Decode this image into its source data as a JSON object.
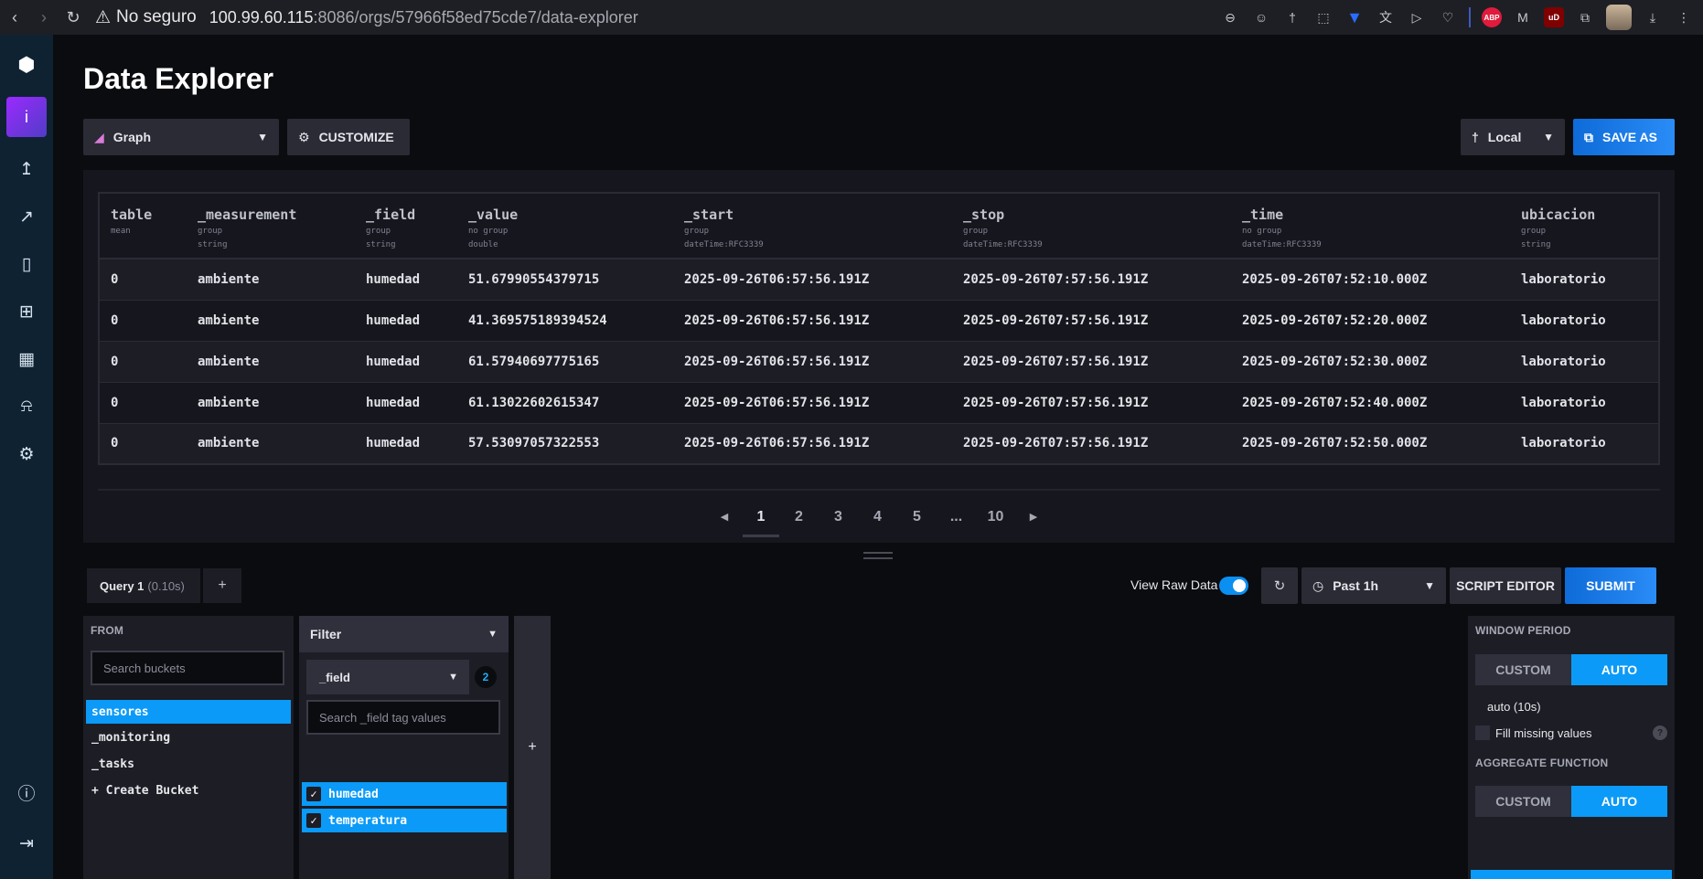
{
  "browser": {
    "security_label": "No seguro",
    "url_host": "100.99.60.115",
    "url_rest": ":8086/orgs/57966f58ed75cde7/data-explorer",
    "extensions": {
      "abp": "ABP",
      "ub": "uD"
    }
  },
  "sidebar": {
    "user_initial": "i",
    "icons": [
      "upload-icon",
      "chart-icon",
      "notebook-icon",
      "dashboard-icon",
      "calendar-icon",
      "bell-icon",
      "gear-icon"
    ],
    "bottom_icons": [
      "help-icon",
      "collapse-icon"
    ]
  },
  "page": {
    "title": "Data Explorer",
    "graph_type": "Graph",
    "customize_label": "CUSTOMIZE",
    "timezone_label": "Local",
    "save_as_label": "SAVE AS"
  },
  "table": {
    "columns": [
      {
        "name": "table",
        "meta1": "mean",
        "meta2": ""
      },
      {
        "name": "_measurement",
        "meta1": "group",
        "meta2": "string"
      },
      {
        "name": "_field",
        "meta1": "group",
        "meta2": "string"
      },
      {
        "name": "_value",
        "meta1": "no group",
        "meta2": "double"
      },
      {
        "name": "_start",
        "meta1": "group",
        "meta2": "dateTime:RFC3339"
      },
      {
        "name": "_stop",
        "meta1": "group",
        "meta2": "dateTime:RFC3339"
      },
      {
        "name": "_time",
        "meta1": "no group",
        "meta2": "dateTime:RFC3339"
      },
      {
        "name": "ubicacion",
        "meta1": "group",
        "meta2": "string"
      }
    ],
    "rows": [
      [
        "0",
        "ambiente",
        "humedad",
        "51.67990554379715",
        "2025-09-26T06:57:56.191Z",
        "2025-09-26T07:57:56.191Z",
        "2025-09-26T07:52:10.000Z",
        "laboratorio"
      ],
      [
        "0",
        "ambiente",
        "humedad",
        "41.369575189394524",
        "2025-09-26T06:57:56.191Z",
        "2025-09-26T07:57:56.191Z",
        "2025-09-26T07:52:20.000Z",
        "laboratorio"
      ],
      [
        "0",
        "ambiente",
        "humedad",
        "61.57940697775165",
        "2025-09-26T06:57:56.191Z",
        "2025-09-26T07:57:56.191Z",
        "2025-09-26T07:52:30.000Z",
        "laboratorio"
      ],
      [
        "0",
        "ambiente",
        "humedad",
        "61.13022602615347",
        "2025-09-26T06:57:56.191Z",
        "2025-09-26T07:57:56.191Z",
        "2025-09-26T07:52:40.000Z",
        "laboratorio"
      ],
      [
        "0",
        "ambiente",
        "humedad",
        "57.53097057322553",
        "2025-09-26T06:57:56.191Z",
        "2025-09-26T07:57:56.191Z",
        "2025-09-26T07:52:50.000Z",
        "laboratorio"
      ]
    ]
  },
  "pagination": {
    "pages": [
      "1",
      "2",
      "3",
      "4",
      "5",
      "...",
      "10"
    ],
    "current": "1"
  },
  "query": {
    "tab_label": "Query 1",
    "tab_time": "(0.10s)",
    "add_label": "+",
    "view_raw_label": "View Raw Data",
    "view_raw_on": true,
    "time_range": "Past 1h",
    "script_editor_label": "SCRIPT EDITOR",
    "submit_label": "SUBMIT"
  },
  "from_panel": {
    "heading": "FROM",
    "search_placeholder": "Search buckets",
    "buckets": [
      "sensores",
      "_monitoring",
      "_tasks",
      "+ Create Bucket"
    ],
    "selected": "sensores"
  },
  "filter_panel": {
    "heading": "Filter",
    "tag_key": "_field",
    "selected_count": "2",
    "search_placeholder": "Search _field tag values",
    "values": [
      "humedad",
      "temperatura"
    ]
  },
  "add_filter_label": "+",
  "window_panel": {
    "window_heading": "WINDOW PERIOD",
    "custom_label": "CUSTOM",
    "auto_label": "AUTO",
    "auto_value": "auto (10s)",
    "fill_missing_label": "Fill missing values",
    "aggregate_heading": "AGGREGATE FUNCTION"
  },
  "colors": {
    "accent": "#0b9af7",
    "submit": "#2a8cf6",
    "sidebar": "#0f2232"
  }
}
